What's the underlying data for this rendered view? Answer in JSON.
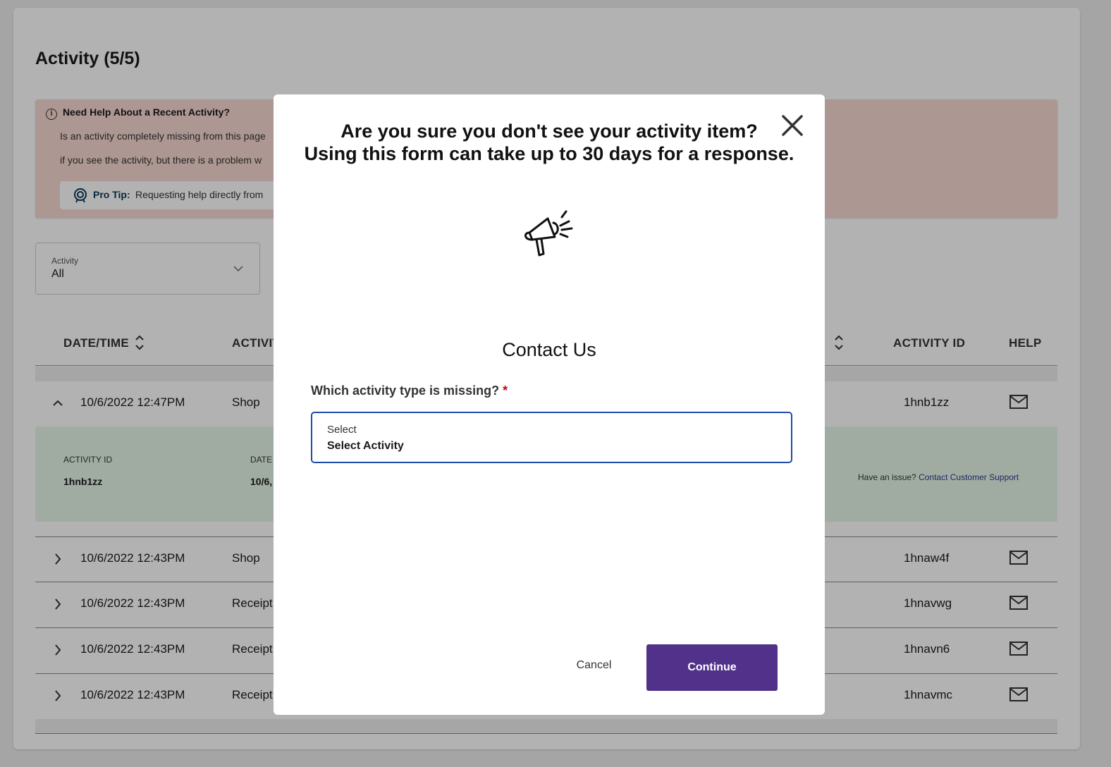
{
  "page": {
    "title": "Activity (5/5)"
  },
  "help_box": {
    "heading": "Need Help About a Recent Activity?",
    "line1": "Is an activity completely missing from this page",
    "line2": "if you see the activity, but there is a problem w",
    "protip_label": "Pro Tip:",
    "protip_text": "Requesting help directly from"
  },
  "filter": {
    "label": "Activity",
    "value": "All"
  },
  "table": {
    "headers": {
      "date_time": "DATE/TIME",
      "activity": "ACTIVIT",
      "activity_id": "ACTIVITY ID",
      "help": "HELP"
    },
    "rows": [
      {
        "date": "10/6/2022 12:47PM",
        "activity": "Shop",
        "id": "1hnb1zz",
        "expanded": true
      },
      {
        "date": "10/6/2022 12:43PM",
        "activity": "Shop",
        "id": "1hnaw4f",
        "expanded": false
      },
      {
        "date": "10/6/2022 12:43PM",
        "activity": "Receipt",
        "id": "1hnavwg",
        "expanded": false
      },
      {
        "date": "10/6/2022 12:43PM",
        "activity": "Receipt",
        "id": "1hnavn6",
        "expanded": false
      },
      {
        "date": "10/6/2022 12:43PM",
        "activity": "Receipt",
        "id": "1hnavmc",
        "expanded": false
      }
    ],
    "detail": {
      "activity_id_label": "ACTIVITY ID",
      "activity_id_value": "1hnb1zz",
      "date_label": "DATE",
      "date_value": "10/6,",
      "issue_text": "Have an issue?",
      "issue_link": "Contact Customer Support"
    }
  },
  "modal": {
    "title_line1": "Are you sure you don't see your activity item?",
    "title_line2": "Using this form can take up to 30 days for a response.",
    "contact_title": "Contact Us",
    "field_label": "Which activity type is missing?",
    "required_marker": "*",
    "select_label": "Select",
    "select_value": "Select Activity",
    "cancel_label": "Cancel",
    "continue_label": "Continue"
  },
  "colors": {
    "help_box_bg": "#f8d9d1",
    "detail_bg": "#e6f6e8",
    "select_border": "#1f4ba8",
    "continue_bg": "#51318a",
    "required": "#d0021b"
  },
  "icons": [
    "info-icon",
    "pro-tip-icon",
    "chevron-down-icon",
    "sort-icon",
    "chevron-up-icon",
    "chevron-right-icon",
    "mail-icon",
    "close-icon",
    "megaphone-icon"
  ]
}
